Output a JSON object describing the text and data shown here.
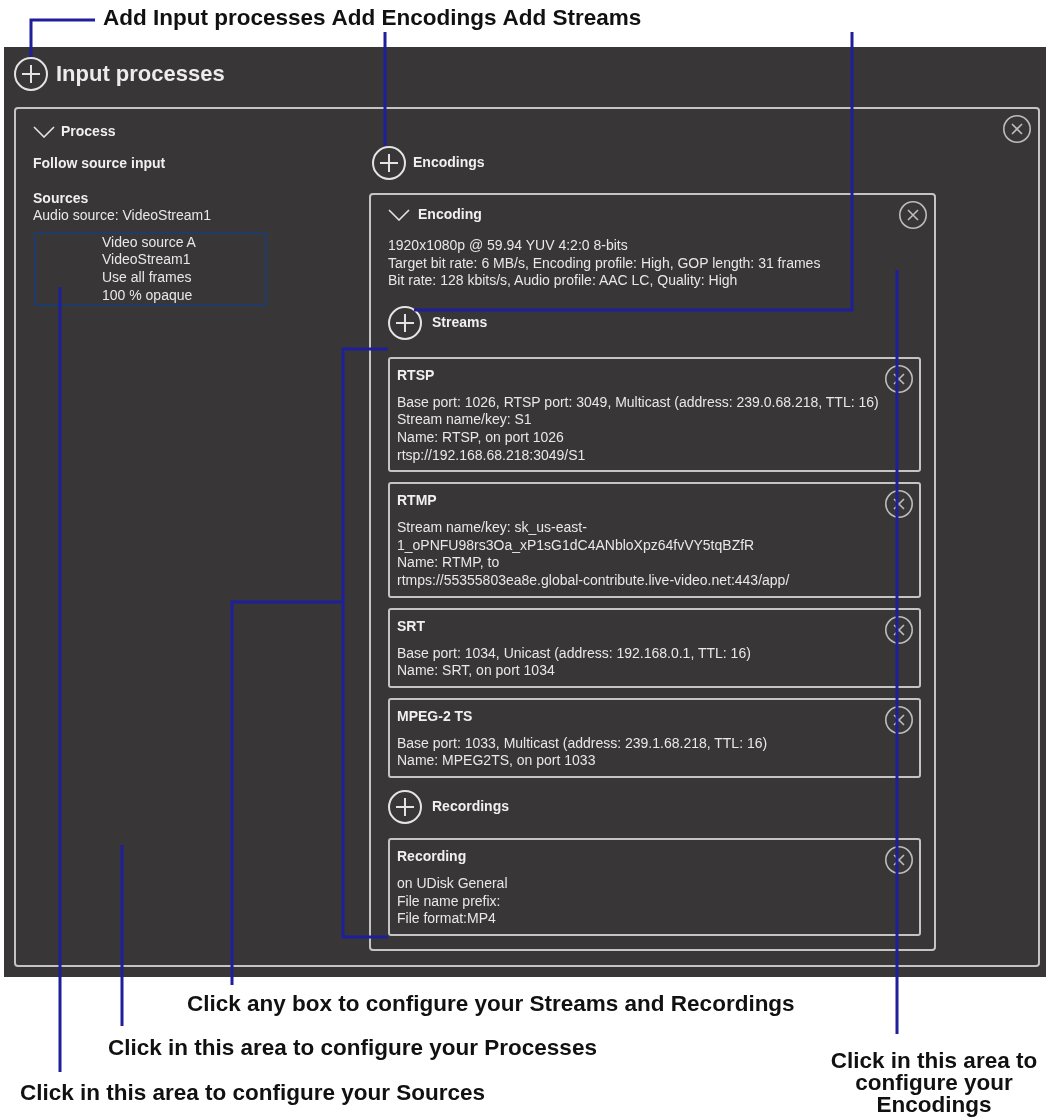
{
  "callouts_top": [
    "Add Input processes",
    "Add Encodings",
    "Add Streams"
  ],
  "panel": {
    "title": "Input processes",
    "process": {
      "title": "Process",
      "expanded": true,
      "mode": "Follow source input",
      "sources_heading": "Sources",
      "audio_source": "Audio source: VideoStream1",
      "video_source": [
        "Video source A",
        "VideoStream1",
        "Use all frames",
        "100 % opaque"
      ],
      "encodings_label": "Encodings",
      "encoding": {
        "title": "Encoding",
        "expanded": true,
        "lines": [
          "1920x1080p @ 59.94 YUV 4:2:0 8-bits",
          "Target bit rate: 6 MB/s, Encoding profile: High, GOP length: 31 frames",
          "Bit rate: 128 kbits/s, Audio profile: AAC LC, Quality: High"
        ],
        "streams_label": "Streams",
        "streams": [
          {
            "title": "RTSP",
            "lines": [
              "Base port: 1026, RTSP port: 3049, Multicast (address: 239.0.68.218, TTL: 16)",
              "Stream name/key: S1",
              "Name: RTSP, on port 1026",
              "rtsp://192.168.68.218:3049/S1"
            ]
          },
          {
            "title": "RTMP",
            "lines": [
              "Stream name/key: sk_us-east-",
              "1_oPNFU98rs3Oa_xP1sG1dC4ANbloXpz64fvVY5tqBZfR",
              "Name: RTMP, to",
              "rtmps://55355803ea8e.global-contribute.live-video.net:443/app/"
            ]
          },
          {
            "title": "SRT",
            "lines": [
              "Base port: 1034, Unicast (address: 192.168.0.1, TTL: 16)",
              "Name: SRT, on port 1034"
            ]
          },
          {
            "title": "MPEG-2 TS",
            "lines": [
              "Base port: 1033, Multicast (address: 239.1.68.218, TTL: 16)",
              "Name: MPEG2TS, on port 1033"
            ]
          }
        ],
        "recordings_label": "Recordings",
        "recordings": [
          {
            "title": "Recording",
            "lines": [
              "on UDisk General",
              "File name prefix:",
              "File format:MP4"
            ]
          }
        ]
      }
    }
  },
  "callouts_bottom": [
    "Click any box to configure your Streams and Recordings",
    "Click in this area to configure your Processes",
    "Click in this area to configure your Sources",
    "Click in this area to configure your Encodings"
  ]
}
